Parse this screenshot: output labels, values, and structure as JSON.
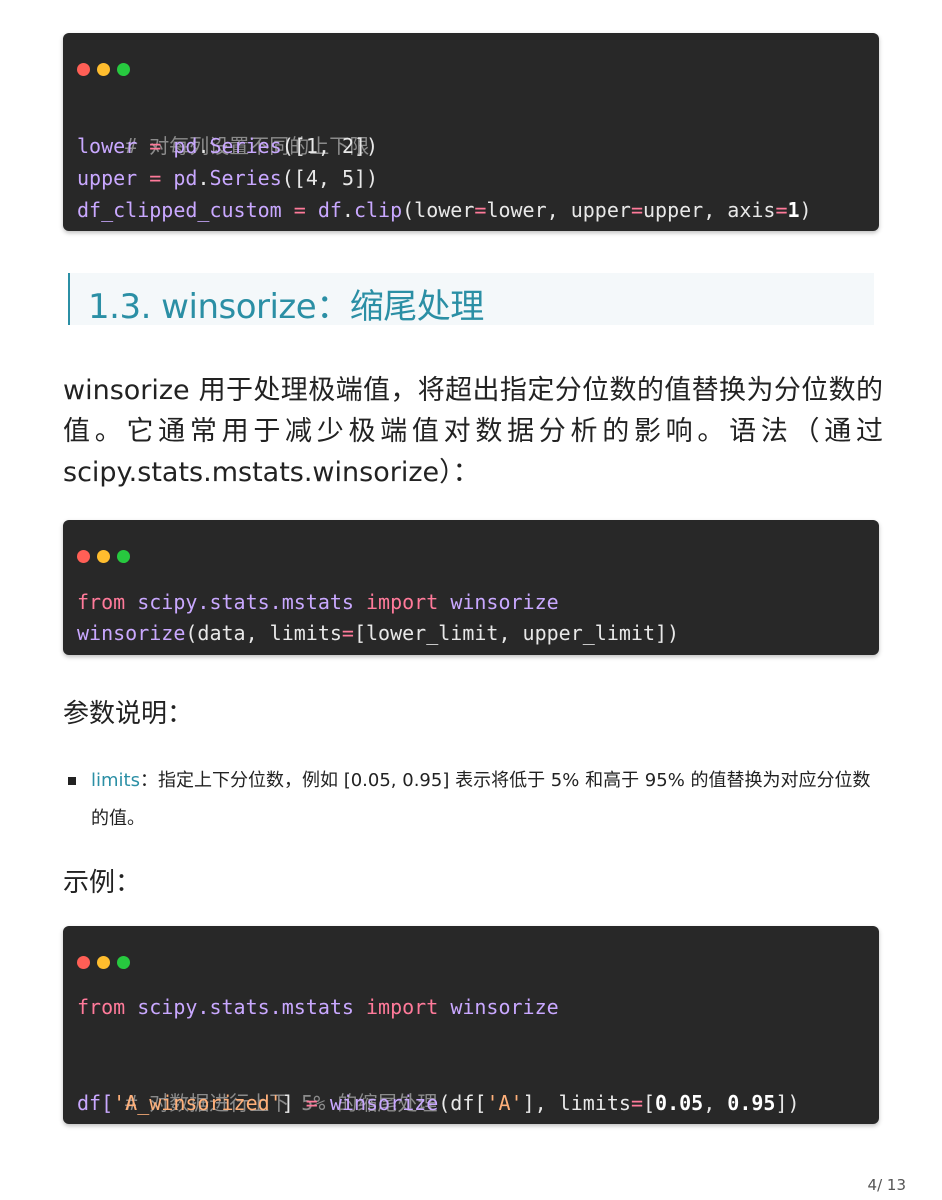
{
  "code1": {
    "comment": "# 对每列设置不同的上下限",
    "l2_var": "lower",
    "l2_eq": " = ",
    "l2_obj": "pd",
    "l2_dot": ".",
    "l2_fn": "Series",
    "l2_args": "([1, 2])",
    "l3_var": "upper",
    "l3_eq": " = ",
    "l3_obj": "pd",
    "l3_dot": ".",
    "l3_fn": "Series",
    "l3_args": "([4, 5])",
    "l4_var": "df_clipped_custom",
    "l4_eq": " = ",
    "l4_obj": "df",
    "l4_dot": ".",
    "l4_fn": "clip",
    "l4_p1": "(lower",
    "l4_e1": "=",
    "l4_p2": "lower, upper",
    "l4_e2": "=",
    "l4_p3": "upper, axis",
    "l4_e3": "=",
    "l4_n": "1",
    "l4_end": ")"
  },
  "heading": "1.3. winsorize：缩尾处理",
  "paragraph": "winsorize 用于处理极端值，将超出指定分位数的值替换为分位数的值。它通常用于减少极端值对数据分析的影响。语法（通过 scipy.stats.mstats.winsorize）：",
  "code2": {
    "l1_kw": "from",
    "l1_mod": "scipy.stats.mstats",
    "l1_kw2": "import",
    "l1_name": "winsorize",
    "l2_fn": "winsorize",
    "l2_a": "(data, limits",
    "l2_eq": "=",
    "l2_b": "[lower_limit, upper_limit])"
  },
  "params_label": "参数说明：",
  "bullet": {
    "key": "limits",
    "text": "：指定上下分位数，例如 [0.05, 0.95] 表示将低于 5% 和高于 95% 的值替换为对应分位数的值。"
  },
  "example_label": "示例：",
  "code3": {
    "l1_kw": "from",
    "l1_mod": "scipy.stats.mstats",
    "l1_kw2": "import",
    "l1_name": "winsorize",
    "comment": "# 对数据进行上下 5% 的缩尾处理",
    "l4_a": "df[",
    "l4_s1": "'A_winsorized'",
    "l4_b": "] ",
    "l4_eq": "=",
    "l4_fn": "winsorize",
    "l4_c": "(df[",
    "l4_s2": "'A'",
    "l4_d": "], limits",
    "l4_eq2": "=",
    "l4_e": "[",
    "l4_n1": "0.05",
    "l4_f": ", ",
    "l4_n2": "0.95",
    "l4_g": "])"
  },
  "page_indicator": "4/ 13"
}
